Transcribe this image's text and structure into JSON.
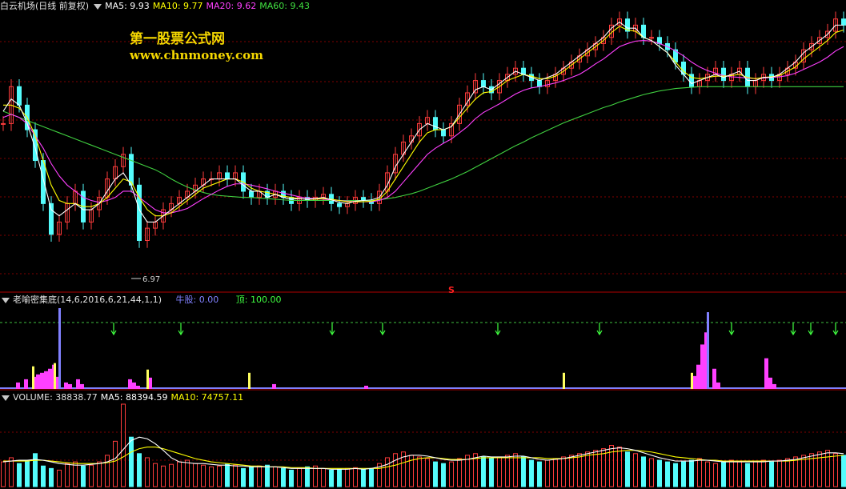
{
  "panels": {
    "price": {
      "title": "白云机场(日线 前复权)",
      "ma5": "MA5: 9.93",
      "ma10": "MA10: 9.77",
      "ma20": "MA20: 9.62",
      "ma60": "MA60: 9.43",
      "low_label": "6.97",
      "signal_marker": "S"
    },
    "indicator": {
      "title": "老喻密集底(14,6,2016,6,21,44,1,1)",
      "bull_label": "牛股: 0.00",
      "top_label": "顶: 100.00"
    },
    "volume": {
      "title": "VOLUME: 38838.77",
      "ma5": "MA5: 88394.59",
      "ma10": "MA10: 74757.11"
    }
  },
  "watermark": {
    "line1": "第一股票公式网",
    "line2": "www.chnmoney.com"
  },
  "colors": {
    "up": "#ff3c3c",
    "down": "#54fcfc",
    "ma5": "#ffffff",
    "ma10": "#ffff00",
    "ma20": "#ff40ff",
    "ma60": "#40d040",
    "grid": "#800000",
    "magenta_bar": "#ff40ff",
    "blue_bar": "#8080ff",
    "yellow_bar": "#ffff60",
    "arrow_green": "#40ff40"
  },
  "chart_data": [
    {
      "type": "candlestick",
      "title": "白云机场(日线 前复权)",
      "ylim": [
        6.5,
        11.0
      ],
      "x": [
        0,
        10,
        20,
        30,
        40,
        50,
        60,
        70,
        80,
        90,
        100,
        110,
        120,
        130,
        140,
        150,
        160,
        170,
        180,
        190,
        200,
        210,
        220,
        230,
        240,
        250,
        260,
        270,
        280,
        290,
        300,
        310,
        320,
        330,
        340,
        350,
        360,
        370,
        380,
        390,
        400,
        410,
        420,
        430,
        440,
        450,
        460,
        470,
        480,
        490,
        500,
        510,
        520,
        530,
        540,
        550,
        560,
        570,
        580,
        590,
        600,
        610,
        620,
        630,
        640,
        650,
        660,
        670,
        680,
        690,
        700,
        710,
        720,
        730,
        740,
        750,
        760,
        770,
        780,
        790,
        800,
        810,
        820,
        830,
        840,
        850,
        860,
        870,
        880,
        890,
        900,
        910,
        920,
        930,
        940,
        950,
        960,
        970,
        980,
        990,
        1000,
        1010,
        1020,
        1030,
        1040,
        1050
      ],
      "close": [
        9.2,
        9.8,
        9.5,
        9.1,
        8.6,
        7.9,
        7.4,
        7.6,
        7.9,
        8.1,
        7.6,
        7.8,
        8.0,
        8.3,
        8.5,
        8.7,
        8.2,
        7.3,
        7.5,
        7.6,
        7.8,
        7.9,
        8.0,
        8.1,
        8.2,
        8.3,
        8.3,
        8.4,
        8.3,
        8.4,
        8.1,
        8.0,
        8.1,
        8.0,
        8.1,
        8.0,
        7.9,
        8.0,
        7.95,
        8.0,
        8.05,
        7.9,
        7.85,
        7.9,
        8.0,
        7.95,
        7.9,
        8.1,
        8.4,
        8.7,
        8.9,
        9.0,
        9.2,
        9.3,
        9.1,
        9.0,
        9.2,
        9.5,
        9.7,
        9.9,
        9.8,
        9.7,
        9.9,
        10.0,
        10.1,
        10.0,
        9.9,
        9.8,
        9.9,
        10.0,
        10.1,
        10.2,
        10.3,
        10.4,
        10.5,
        10.6,
        10.8,
        10.9,
        10.7,
        10.8,
        10.6,
        10.6,
        10.5,
        10.4,
        10.2,
        10.0,
        9.8,
        9.9,
        10.0,
        10.1,
        9.9,
        10.0,
        10.1,
        9.8,
        9.9,
        10.0,
        9.9,
        10.0,
        10.1,
        10.2,
        10.4,
        10.5,
        10.6,
        10.7,
        10.9,
        10.8
      ],
      "ma5": [
        9.4,
        9.6,
        9.5,
        9.2,
        8.8,
        8.3,
        7.8,
        7.7,
        7.8,
        7.9,
        7.8,
        7.8,
        7.9,
        8.1,
        8.3,
        8.4,
        8.2,
        7.8,
        7.6,
        7.6,
        7.7,
        7.8,
        7.9,
        8.0,
        8.1,
        8.2,
        8.3,
        8.3,
        8.3,
        8.3,
        8.2,
        8.1,
        8.1,
        8.0,
        8.05,
        8.0,
        7.97,
        7.98,
        7.97,
        7.98,
        8.0,
        7.96,
        7.92,
        7.9,
        7.94,
        7.95,
        7.96,
        8.0,
        8.2,
        8.5,
        8.7,
        8.9,
        9.1,
        9.2,
        9.15,
        9.1,
        9.15,
        9.35,
        9.55,
        9.75,
        9.8,
        9.75,
        9.85,
        9.95,
        10.05,
        10.0,
        9.95,
        9.9,
        9.95,
        10.0,
        10.1,
        10.2,
        10.3,
        10.4,
        10.5,
        10.6,
        10.75,
        10.85,
        10.75,
        10.75,
        10.6,
        10.55,
        10.45,
        10.35,
        10.15,
        10.0,
        9.85,
        9.9,
        9.95,
        10.0,
        9.95,
        10.0,
        10.05,
        9.9,
        9.9,
        9.95,
        9.95,
        10.0,
        10.1,
        10.2,
        10.35,
        10.45,
        10.55,
        10.65,
        10.8,
        10.8
      ],
      "ma10": [
        9.5,
        9.5,
        9.45,
        9.3,
        9.0,
        8.6,
        8.2,
        7.95,
        7.9,
        7.9,
        7.85,
        7.85,
        7.9,
        8.0,
        8.15,
        8.3,
        8.25,
        8.0,
        7.8,
        7.7,
        7.7,
        7.75,
        7.85,
        7.95,
        8.05,
        8.15,
        8.2,
        8.25,
        8.3,
        8.3,
        8.25,
        8.15,
        8.1,
        8.08,
        8.05,
        8.02,
        8.0,
        7.98,
        7.97,
        7.97,
        7.98,
        7.97,
        7.95,
        7.93,
        7.93,
        7.93,
        7.94,
        7.97,
        8.1,
        8.3,
        8.5,
        8.7,
        8.9,
        9.05,
        9.1,
        9.1,
        9.15,
        9.3,
        9.45,
        9.6,
        9.7,
        9.72,
        9.8,
        9.9,
        9.95,
        10.0,
        9.97,
        9.93,
        9.93,
        9.97,
        10.05,
        10.15,
        10.25,
        10.35,
        10.45,
        10.55,
        10.68,
        10.78,
        10.72,
        10.7,
        10.6,
        10.55,
        10.45,
        10.35,
        10.2,
        10.05,
        9.95,
        9.93,
        9.95,
        9.97,
        9.97,
        9.98,
        10.0,
        9.95,
        9.93,
        9.95,
        9.96,
        9.98,
        10.05,
        10.12,
        10.25,
        10.35,
        10.45,
        10.55,
        10.68,
        10.72
      ],
      "ma20": [
        9.3,
        9.35,
        9.3,
        9.2,
        9.0,
        8.8,
        8.55,
        8.35,
        8.2,
        8.1,
        8.0,
        7.95,
        7.92,
        7.95,
        8.0,
        8.1,
        8.1,
        8.0,
        7.9,
        7.8,
        7.75,
        7.75,
        7.78,
        7.82,
        7.9,
        7.98,
        8.05,
        8.12,
        8.18,
        8.22,
        8.22,
        8.2,
        8.17,
        8.14,
        8.1,
        8.07,
        8.04,
        8.01,
        7.99,
        7.98,
        7.97,
        7.96,
        7.95,
        7.94,
        7.93,
        7.93,
        7.93,
        7.95,
        8.0,
        8.1,
        8.25,
        8.4,
        8.55,
        8.7,
        8.8,
        8.88,
        8.95,
        9.05,
        9.15,
        9.28,
        9.38,
        9.45,
        9.52,
        9.6,
        9.68,
        9.74,
        9.78,
        9.8,
        9.83,
        9.86,
        9.9,
        9.95,
        10.0,
        10.08,
        10.17,
        10.25,
        10.35,
        10.45,
        10.5,
        10.54,
        10.55,
        10.54,
        10.5,
        10.45,
        10.38,
        10.3,
        10.2,
        10.12,
        10.06,
        10.02,
        9.98,
        9.96,
        9.95,
        9.94,
        9.93,
        9.94,
        9.95,
        9.96,
        9.98,
        10.02,
        10.08,
        10.14,
        10.2,
        10.28,
        10.38,
        10.45
      ],
      "ma60": [
        9.4,
        9.35,
        9.3,
        9.25,
        9.2,
        9.15,
        9.1,
        9.05,
        9.0,
        8.95,
        8.9,
        8.85,
        8.8,
        8.75,
        8.7,
        8.65,
        8.6,
        8.55,
        8.5,
        8.45,
        8.38,
        8.3,
        8.23,
        8.17,
        8.12,
        8.08,
        8.05,
        8.03,
        8.02,
        8.01,
        8.0,
        8.0,
        7.99,
        7.98,
        7.97,
        7.96,
        7.95,
        7.95,
        7.95,
        7.95,
        7.95,
        7.95,
        7.95,
        7.95,
        7.95,
        7.95,
        7.95,
        7.96,
        7.98,
        8.0,
        8.03,
        8.06,
        8.1,
        8.15,
        8.2,
        8.25,
        8.3,
        8.36,
        8.42,
        8.49,
        8.56,
        8.63,
        8.7,
        8.77,
        8.84,
        8.9,
        8.97,
        9.03,
        9.09,
        9.15,
        9.21,
        9.26,
        9.31,
        9.36,
        9.41,
        9.46,
        9.5,
        9.55,
        9.59,
        9.63,
        9.67,
        9.7,
        9.73,
        9.75,
        9.77,
        9.78,
        9.79,
        9.8,
        9.8,
        9.8,
        9.8,
        9.8,
        9.8,
        9.8,
        9.8,
        9.8,
        9.8,
        9.8,
        9.8,
        9.8,
        9.8,
        9.8,
        9.8,
        9.8,
        9.8,
        9.8
      ]
    },
    {
      "type": "bar",
      "title": "老喻密集底(14,6,2016,6,21,44,1,1)",
      "magenta_x": [
        20,
        30,
        40,
        45,
        50,
        55,
        60,
        65,
        70,
        80,
        85,
        95,
        100,
        160,
        165,
        170,
        185,
        340,
        455,
        865,
        870,
        875,
        880,
        890,
        895,
        955,
        960,
        965
      ],
      "magenta_values": [
        8,
        12,
        15,
        18,
        20,
        22,
        25,
        30,
        15,
        8,
        6,
        12,
        6,
        12,
        8,
        4,
        14,
        6,
        4,
        16,
        30,
        55,
        70,
        25,
        8,
        38,
        14,
        6
      ],
      "blue_x": [
        73,
        883
      ],
      "blue_values": [
        100,
        95
      ],
      "yellow_x": [
        40,
        67,
        183,
        310,
        703,
        863
      ],
      "yellow_values": [
        28,
        32,
        24,
        20,
        20,
        20
      ],
      "arrow_x": [
        142,
        226,
        415,
        478,
        622,
        749,
        914,
        991,
        1013,
        1044
      ],
      "ylim": [
        0,
        100
      ]
    },
    {
      "type": "bar",
      "title": "VOLUME: 38838.77",
      "note_values": "per-candle volume (relative)",
      "values": [
        30,
        35,
        28,
        32,
        40,
        25,
        22,
        20,
        28,
        30,
        25,
        26,
        30,
        38,
        55,
        100,
        60,
        40,
        35,
        28,
        25,
        27,
        30,
        32,
        28,
        26,
        24,
        25,
        27,
        26,
        22,
        24,
        25,
        26,
        24,
        22,
        20,
        22,
        24,
        25,
        22,
        20,
        21,
        22,
        23,
        21,
        22,
        28,
        35,
        40,
        42,
        38,
        36,
        34,
        30,
        28,
        30,
        34,
        38,
        40,
        36,
        34,
        36,
        38,
        40,
        36,
        32,
        30,
        32,
        34,
        36,
        38,
        40,
        42,
        44,
        46,
        50,
        48,
        42,
        40,
        36,
        34,
        32,
        30,
        28,
        30,
        32,
        34,
        30,
        28,
        30,
        32,
        30,
        28,
        30,
        32,
        30,
        32,
        34,
        36,
        38,
        40,
        42,
        44,
        40,
        38
      ],
      "ma5": [
        30,
        31,
        32,
        32,
        33,
        32,
        30,
        28,
        27,
        26,
        26,
        27,
        28,
        30,
        34,
        45,
        56,
        60,
        58,
        52,
        44,
        35,
        30,
        29,
        28,
        28,
        27,
        26,
        26,
        25,
        25,
        24,
        24,
        24,
        24,
        23,
        22,
        22,
        22,
        22,
        22,
        21,
        21,
        21,
        22,
        21,
        22,
        24,
        27,
        32,
        36,
        38,
        38,
        37,
        35,
        33,
        32,
        32,
        33,
        35,
        37,
        36,
        36,
        36,
        37,
        37,
        35,
        33,
        32,
        33,
        34,
        36,
        38,
        40,
        42,
        44,
        46,
        47,
        46,
        44,
        41,
        38,
        35,
        33,
        31,
        31,
        31,
        32,
        32,
        31,
        30,
        30,
        30,
        30,
        30,
        30,
        31,
        31,
        32,
        33,
        35,
        37,
        39,
        41,
        41,
        40
      ],
      "ma10": [
        31,
        31,
        31,
        31,
        32,
        32,
        31,
        30,
        29,
        28,
        28,
        28,
        28,
        29,
        31,
        36,
        42,
        46,
        48,
        48,
        46,
        43,
        40,
        37,
        34,
        32,
        30,
        29,
        28,
        27,
        26,
        25,
        25,
        24,
        24,
        24,
        23,
        23,
        23,
        22,
        22,
        22,
        22,
        22,
        22,
        22,
        22,
        22,
        24,
        26,
        29,
        32,
        34,
        35,
        35,
        34,
        33,
        33,
        33,
        34,
        35,
        35,
        35,
        35,
        35,
        35,
        35,
        35,
        34,
        34,
        34,
        35,
        36,
        38,
        39,
        40,
        42,
        43,
        44,
        44,
        43,
        42,
        40,
        38,
        36,
        35,
        34,
        33,
        32,
        32,
        31,
        31,
        31,
        31,
        31,
        31,
        31,
        31,
        31,
        32,
        33,
        34,
        35,
        36,
        37,
        38
      ]
    }
  ]
}
